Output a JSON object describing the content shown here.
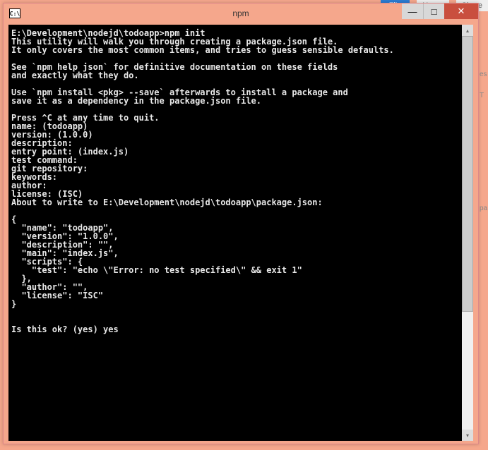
{
  "background": {
    "file_label": "File",
    "home_label": "Home",
    "share_label": "Share",
    "side1": "es",
    "side2": "T",
    "side3": "pa"
  },
  "window": {
    "icon_text": "C:\\",
    "title": "npm",
    "controls": {
      "minimize": "—",
      "maximize": "□",
      "close": "✕"
    }
  },
  "terminal": {
    "content": "E:\\Development\\nodejd\\todoapp>npm init\nThis utility will walk you through creating a package.json file.\nIt only covers the most common items, and tries to guess sensible defaults.\n\nSee `npm help json` for definitive documentation on these fields\nand exactly what they do.\n\nUse `npm install <pkg> --save` afterwards to install a package and\nsave it as a dependency in the package.json file.\n\nPress ^C at any time to quit.\nname: (todoapp)\nversion: (1.0.0)\ndescription:\nentry point: (index.js)\ntest command:\ngit repository:\nkeywords:\nauthor:\nlicense: (ISC)\nAbout to write to E:\\Development\\nodejd\\todoapp\\package.json:\n\n{\n  \"name\": \"todoapp\",\n  \"version\": \"1.0.0\",\n  \"description\": \"\",\n  \"main\": \"index.js\",\n  \"scripts\": {\n    \"test\": \"echo \\\"Error: no test specified\\\" && exit 1\"\n  },\n  \"author\": \"\",\n  \"license\": \"ISC\"\n}\n\n\nIs this ok? (yes) yes"
  },
  "scrollbar": {
    "up": "▴",
    "down": "▾"
  }
}
